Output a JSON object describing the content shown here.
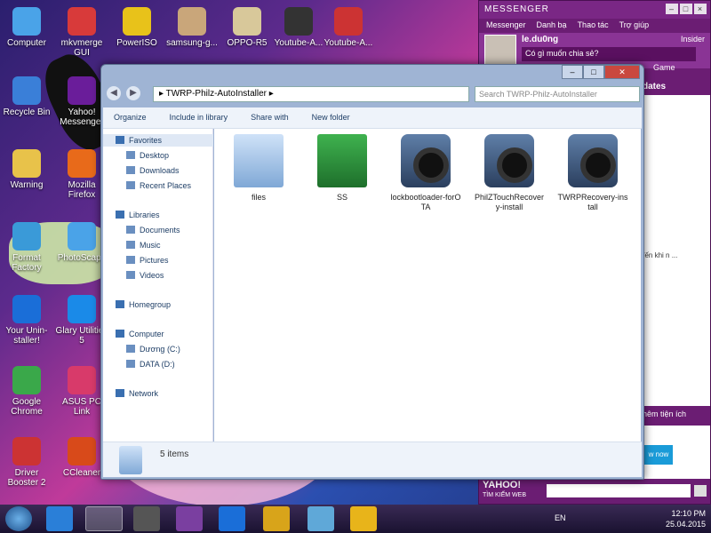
{
  "desktop_icons": [
    {
      "label": "Computer",
      "name": "computer-icon"
    },
    {
      "label": "mkvmerge GUI",
      "name": "mkvmerge-icon"
    },
    {
      "label": "PowerISO",
      "name": "poweriso-icon"
    },
    {
      "label": "samsung-g...",
      "name": "folder-icon"
    },
    {
      "label": "OPPO-R5",
      "name": "folder-icon"
    },
    {
      "label": "Youtube-A...",
      "name": "video-icon"
    },
    {
      "label": "Youtube-A...",
      "name": "video-icon"
    },
    {
      "label": "Recycle Bin",
      "name": "recycle-bin-icon"
    },
    {
      "label": "Yahoo! Messenger",
      "name": "yahoo-messenger-icon"
    },
    {
      "label": "Warning",
      "name": "folder-icon"
    },
    {
      "label": "Mozilla Firefox",
      "name": "firefox-icon"
    },
    {
      "label": "Format Factory",
      "name": "format-factory-icon"
    },
    {
      "label": "PhotoScape",
      "name": "photoscape-icon"
    },
    {
      "label": "Your Unin-staller!",
      "name": "uninstaller-icon"
    },
    {
      "label": "Glary Utilities 5",
      "name": "glary-icon"
    },
    {
      "label": "Google Chrome",
      "name": "chrome-icon"
    },
    {
      "label": "ASUS PC Link",
      "name": "asus-pclink-icon"
    },
    {
      "label": "Driver Booster 2",
      "name": "driver-booster-icon"
    },
    {
      "label": "CCleaner",
      "name": "ccleaner-icon"
    }
  ],
  "messenger": {
    "title": "MESSENGER",
    "menu": [
      "Messenger",
      "Danh bạ",
      "Thao tác",
      "Trợ giúp"
    ],
    "username": "le.du0ng",
    "insider": "Insider",
    "status": "Có gì muốn chia sẻ?",
    "game": "Game",
    "updates": "dates",
    "snippet": "đến khi n ...",
    "ext": "hêm tiện ích",
    "now": "w now",
    "yahoo": "YAHOO!",
    "yahoo_sub": "TÌM KIẾM WEB"
  },
  "explorer": {
    "address": "TWRP-Philz-AutoInstaller",
    "search_placeholder": "Search TWRP-Philz-AutoInstaller",
    "toolbar": [
      "Organize",
      "Include in library",
      "Share with",
      "New folder"
    ],
    "nav": [
      {
        "label": "Favorites",
        "sel": true,
        "indent": 0
      },
      {
        "label": "Desktop",
        "indent": 1
      },
      {
        "label": "Downloads",
        "indent": 1
      },
      {
        "label": "Recent Places",
        "indent": 1
      },
      {
        "label": "Libraries",
        "indent": 0,
        "gap": true
      },
      {
        "label": "Documents",
        "indent": 1
      },
      {
        "label": "Music",
        "indent": 1
      },
      {
        "label": "Pictures",
        "indent": 1
      },
      {
        "label": "Videos",
        "indent": 1
      },
      {
        "label": "Homegroup",
        "indent": 0,
        "gap": true
      },
      {
        "label": "Computer",
        "indent": 0,
        "gap": true
      },
      {
        "label": "Dương (C:)",
        "indent": 1
      },
      {
        "label": "DATA (D:)",
        "indent": 1
      },
      {
        "label": "Network",
        "indent": 0,
        "gap": true
      }
    ],
    "files": [
      {
        "label": "files",
        "type": "folder-blue"
      },
      {
        "label": "SS",
        "type": "folder-green"
      },
      {
        "label": "lockbootloader-forOTA",
        "type": "gear"
      },
      {
        "label": "PhilZTouchRecovery-install",
        "type": "gear"
      },
      {
        "label": "TWRPRecovery-install",
        "type": "gear"
      }
    ],
    "status": "5 items"
  },
  "taskbar": {
    "lang": "EN",
    "time": "12:10 PM",
    "date": "25.04.2015"
  }
}
